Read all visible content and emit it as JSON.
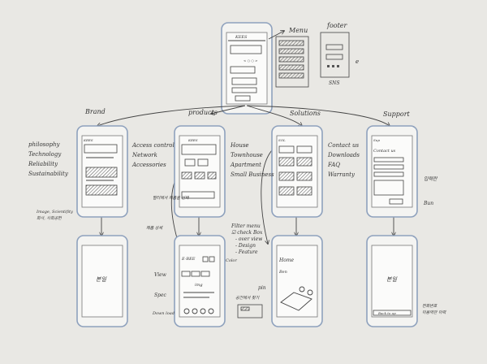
{
  "top_labels": {
    "menu": "Menu",
    "footer": "footer",
    "sns": "SNS"
  },
  "branches": {
    "brand": "Brand",
    "products": "products",
    "solutions": "Solutions",
    "support": "Support"
  },
  "brand_list": [
    "philosophy",
    "Technology",
    "Reliability",
    "Sustainability"
  ],
  "brand_note": [
    "Image, Scientifity",
    "회사, 사회공헌"
  ],
  "products_list": [
    "Access control",
    "Network",
    "Accessories"
  ],
  "solutions_list": [
    "House",
    "Townhouse",
    "Apartment",
    "Small Business"
  ],
  "support_list": [
    "Contact us",
    "Downloads",
    "FAQ",
    "Warranty"
  ],
  "screens": {
    "home_logo": "KEES",
    "brand_header": "KEES",
    "products_header": "KEES",
    "solutions_header": "SOL",
    "support_header": "Sup",
    "support_title": "Contact us",
    "product_detail_header": "E-BEE",
    "product_detail_img": "img",
    "solution_detail_header": "Home",
    "solution_detail_sub": "Ben",
    "support_detail_text": "본일",
    "brand_detail_text": "본일",
    "back_to_top": "Back to up"
  },
  "notes": {
    "support_side": "입력란",
    "support_button": "Bun",
    "products_note_a": "필터에서\n제품을 선택",
    "products_note_b": "제품\n상세",
    "filter_note": [
      "Filter menu",
      "☑ check Box",
      "- over view",
      "- Design",
      "- Feature"
    ],
    "color_note": "Color",
    "detail_labels": [
      "View",
      "Spec",
      "Down load"
    ],
    "pin_note": "pin",
    "map_note": "공간에서 찾기",
    "support_bottom": [
      "전화번호",
      "이용약관 이력"
    ]
  }
}
